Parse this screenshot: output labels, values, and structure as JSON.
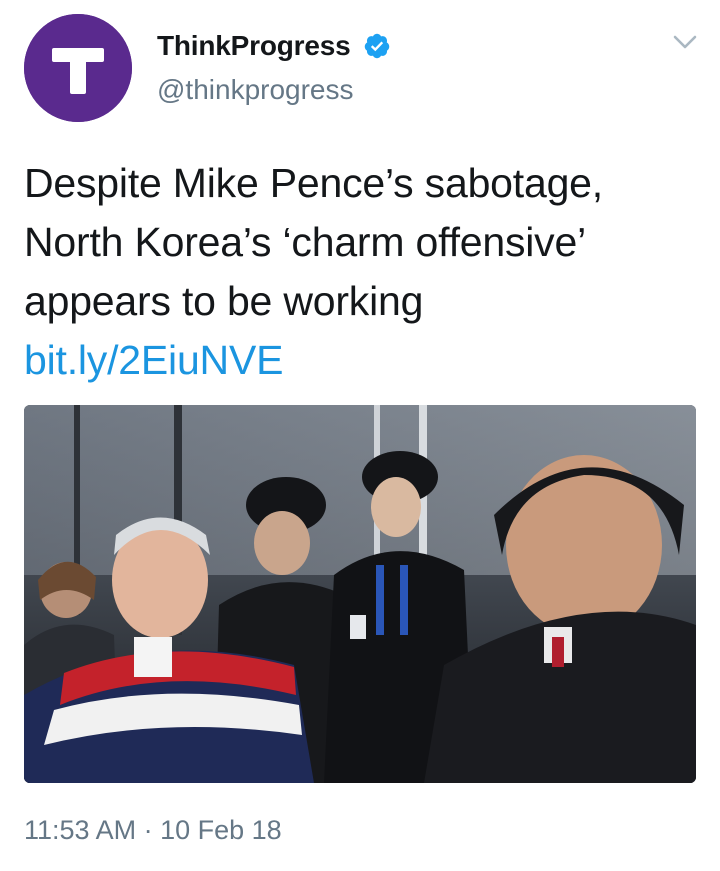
{
  "account": {
    "name": "ThinkProgress",
    "handle": "@thinkprogress",
    "avatar_letter": "T",
    "avatar_color": "#5a2a8e",
    "verified_icon": "verified-badge-icon"
  },
  "tweet": {
    "text_lines": [
      "Despite Mike Pence’s sabotage,",
      "North Korea’s ‘charm offensive’",
      "appears to be working"
    ],
    "link": "bit.ly/2EiuNVE",
    "timestamp": "11:53 AM · 10 Feb 18"
  },
  "menu_icon": "chevron-down-icon",
  "colors": {
    "link": "#1b95e0",
    "secondary_text": "#657786",
    "verified": "#1da1f2"
  }
}
